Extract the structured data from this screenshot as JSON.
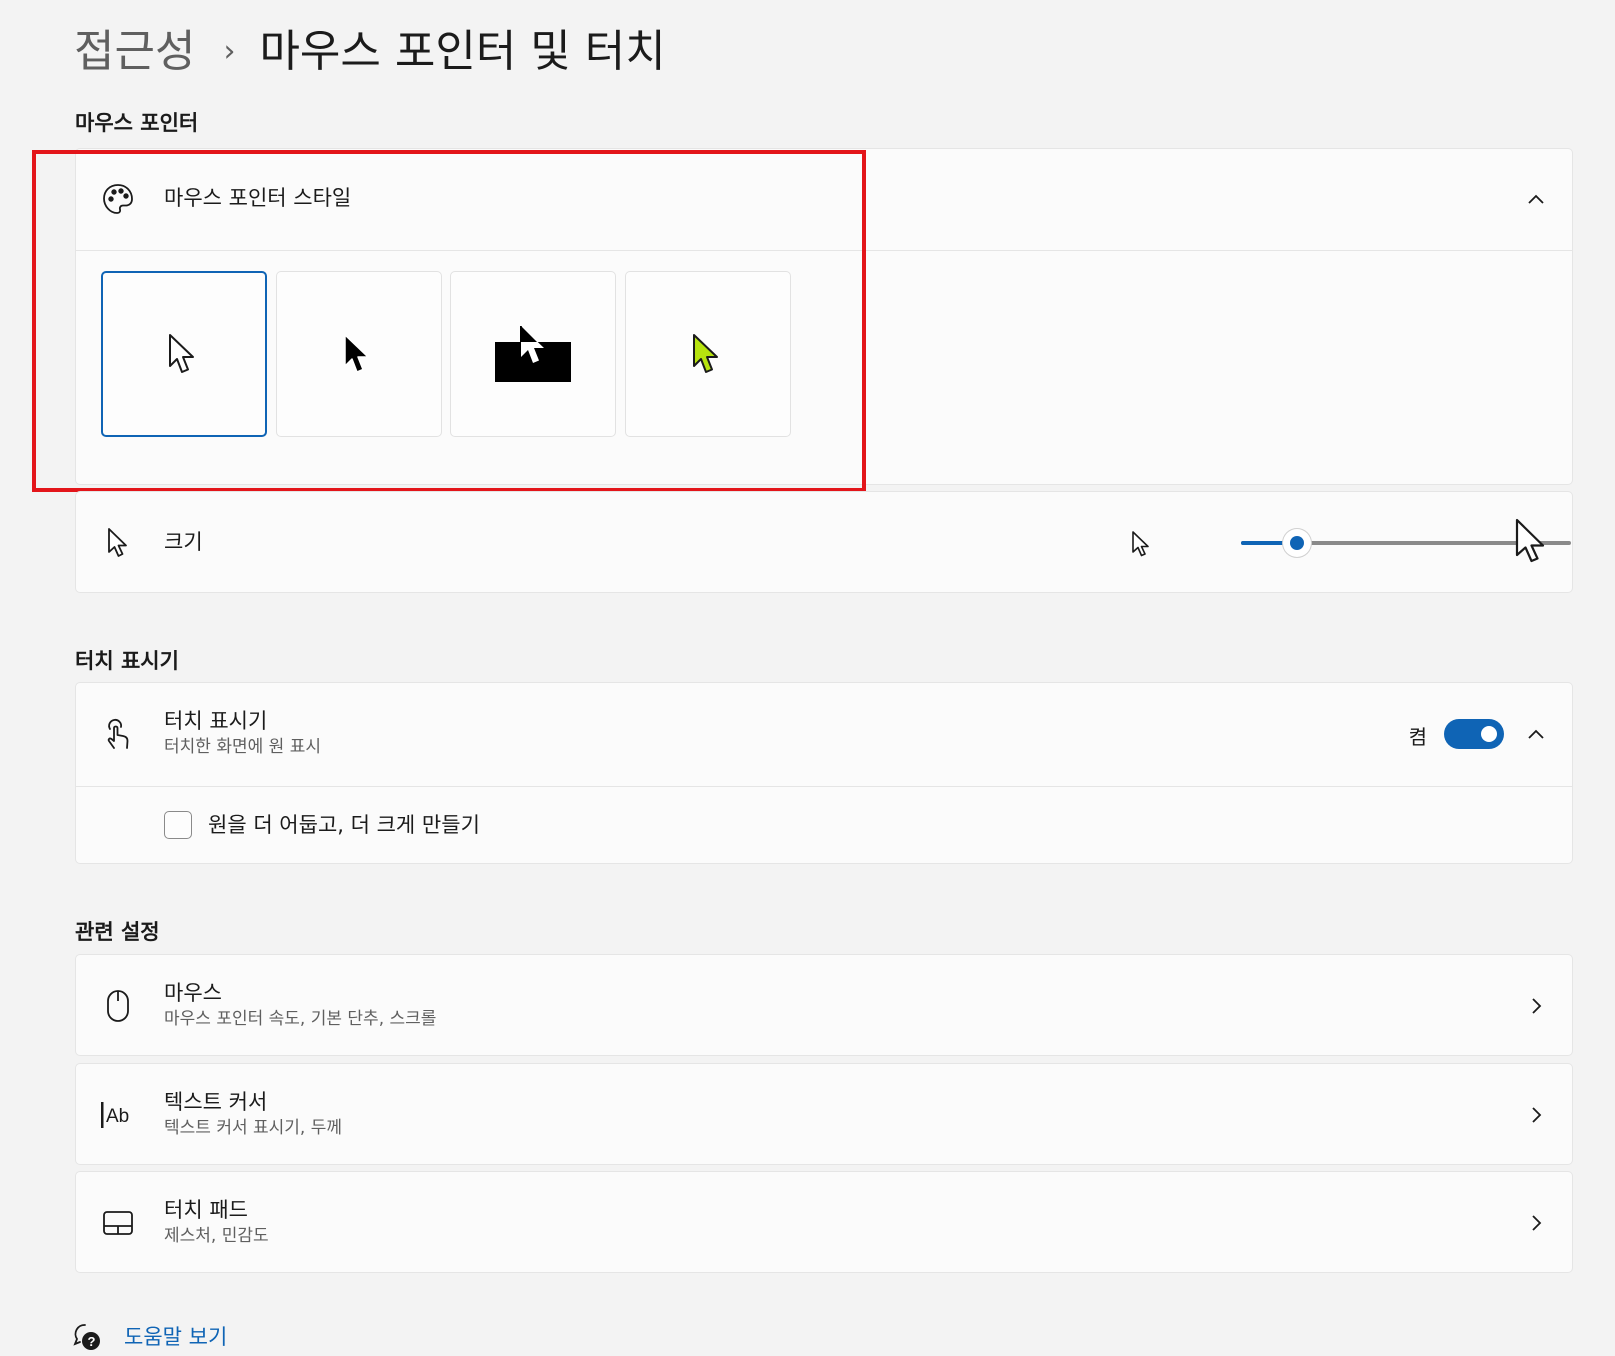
{
  "breadcrumb": {
    "parent": "접근성",
    "separator": "›",
    "current": "마우스 포인터 및 터치"
  },
  "sections": {
    "mouse_pointer": "마우스 포인터",
    "touch_indicator": "터치 표시기",
    "related": "관련 설정"
  },
  "pointer_style": {
    "title": "마우스 포인터 스타일",
    "icon": "palette-icon",
    "expanded": true,
    "options": [
      {
        "name": "white",
        "selected": true
      },
      {
        "name": "black",
        "selected": false
      },
      {
        "name": "inverted",
        "selected": false
      },
      {
        "name": "custom",
        "selected": false,
        "color": "#b7e30f"
      }
    ]
  },
  "size": {
    "title": "크기",
    "icon": "pointer-icon",
    "slider_value_fraction": 0.17
  },
  "touch": {
    "title": "터치 표시기",
    "subtitle": "터치한 화면에 원 표시",
    "icon": "touch-hand-icon",
    "toggle_label": "켬",
    "toggle_on": true,
    "checkbox_label": "원을 더 어둡고, 더 크게 만들기",
    "checkbox_checked": false
  },
  "related": [
    {
      "title": "마우스",
      "subtitle": "마우스 포인터 속도, 기본 단추, 스크롤",
      "icon": "mouse-icon"
    },
    {
      "title": "텍스트 커서",
      "subtitle": "텍스트 커서 표시기, 두께",
      "icon": "text-cursor-icon"
    },
    {
      "title": "터치 패드",
      "subtitle": "제스처, 민감도",
      "icon": "touchpad-icon"
    }
  ],
  "help": {
    "label": "도움말 보기",
    "icon": "help-icon"
  },
  "colors": {
    "accent": "#0f64b5",
    "highlight": "#e3151a",
    "custom_pointer": "#b7e30f"
  }
}
